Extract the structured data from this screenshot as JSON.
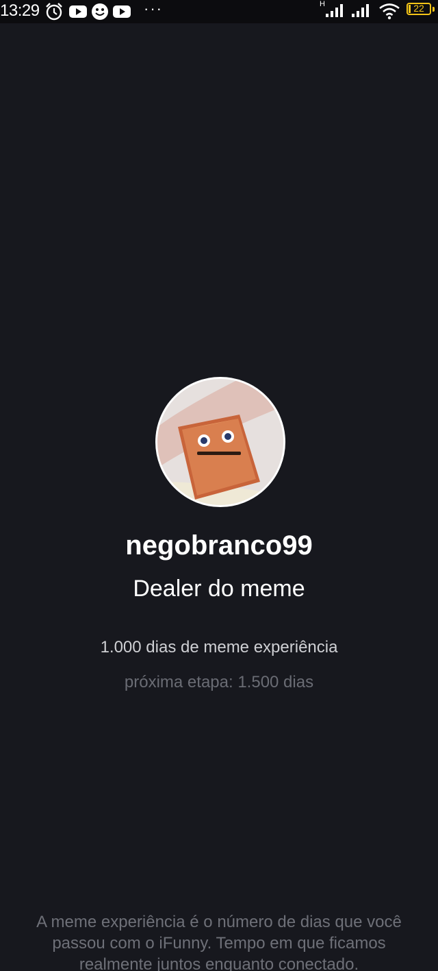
{
  "status_bar": {
    "time": "13:29",
    "more_indicator": "···",
    "network_type": "H",
    "battery_level": "22",
    "icons": [
      "alarm-icon",
      "youtube-icon",
      "smiley-icon",
      "youtube-icon",
      "signal-icon",
      "signal-icon",
      "wifi-icon",
      "battery-icon"
    ]
  },
  "profile": {
    "username": "negobranco99",
    "rank_title": "Dealer do meme",
    "experience_text": "1.000 dias de meme experiência",
    "next_stage_text": "próxima etapa: 1.500 dias",
    "explanation_text": "A meme experiência é o número de dias que você passou com o iFunny. Tempo em que ficamos realmente juntos enquanto conectado."
  },
  "colors": {
    "background": "#17181e",
    "status_bar": "#0c0c0f",
    "battery": "#f5c518",
    "primary_text": "#ffffff",
    "secondary_text": "#cfd0d4",
    "muted_text": "#6a6c74"
  }
}
